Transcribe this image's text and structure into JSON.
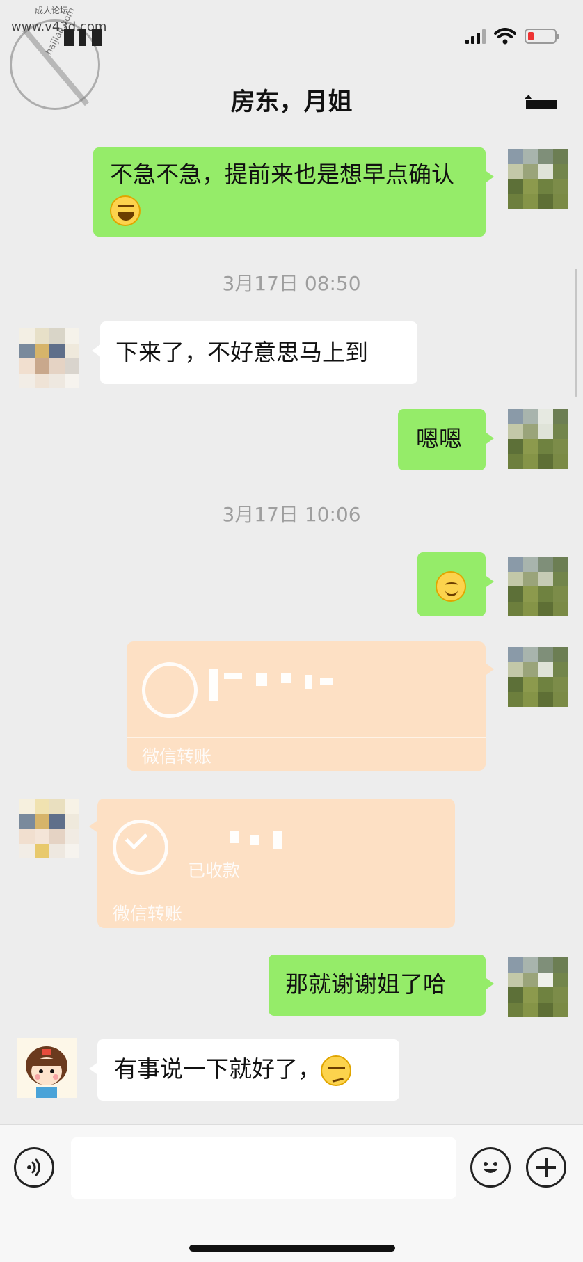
{
  "watermark": {
    "top_text": "成人论坛",
    "url": "www.v43d.com",
    "sub_text": "haijiao.com"
  },
  "header": {
    "title": "房东，月姐"
  },
  "messages": [
    {
      "side": "right",
      "type": "text",
      "text": "不急不急，提前来也是想早点确认",
      "emoji": "laughing-crying-emoji"
    },
    {
      "type": "timestamp",
      "text": "3月17日 08:50"
    },
    {
      "side": "left",
      "type": "text",
      "text": "下来了，不好意思马上到"
    },
    {
      "side": "right",
      "type": "text",
      "text": "嗯嗯"
    },
    {
      "type": "timestamp",
      "text": "3月17日 10:06"
    },
    {
      "side": "right",
      "type": "emoji",
      "emoji": "smile-emoji"
    },
    {
      "side": "right",
      "type": "transfer",
      "label": "微信转账"
    },
    {
      "side": "left",
      "type": "transfer",
      "status": "已收款",
      "label": "微信转账"
    },
    {
      "side": "right",
      "type": "text",
      "text": "那就谢谢姐了哈"
    },
    {
      "side": "left",
      "type": "text",
      "text": "有事说一下就好了，",
      "emoji": "smirk-emoji"
    }
  ],
  "input_bar": {
    "voice_icon": "voice-icon",
    "emoji_icon": "emoji-icon",
    "plus_icon": "plus-icon"
  },
  "colors": {
    "background": "#ededed",
    "bubble_green": "#95ec69",
    "bubble_white": "#ffffff",
    "transfer_orange": "#fde0c4",
    "timestamp_gray": "#9e9e9e"
  }
}
